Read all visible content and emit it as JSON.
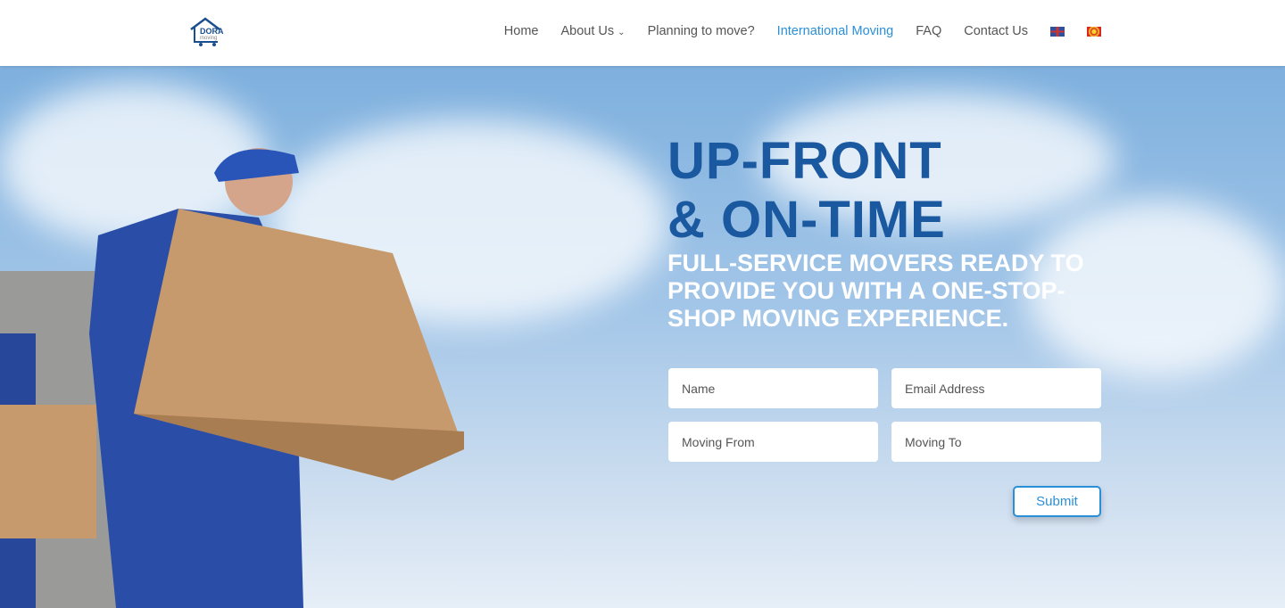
{
  "header": {
    "logo_text": "DORA moving",
    "nav": [
      {
        "label": "Home"
      },
      {
        "label": "About Us",
        "dropdown": true
      },
      {
        "label": "Planning to move?"
      },
      {
        "label": "International Moving",
        "active": true
      },
      {
        "label": "FAQ"
      },
      {
        "label": "Contact Us"
      }
    ],
    "flags": [
      "english-flag",
      "macedonian-flag"
    ],
    "active_color": "#2a8fd9"
  },
  "hero": {
    "title_line1": "UP-FRONT",
    "title_line2": "& ON-TIME",
    "subtitle": "FULL-SERVICE MOVERS READY TO PROVIDE YOU WITH A ONE-STOP-SHOP MOVING EXPERIENCE.",
    "form": {
      "name_placeholder": "Name",
      "email_placeholder": "Email Address",
      "from_placeholder": "Moving From",
      "to_placeholder": "Moving To",
      "submit_label": "Submit"
    }
  }
}
